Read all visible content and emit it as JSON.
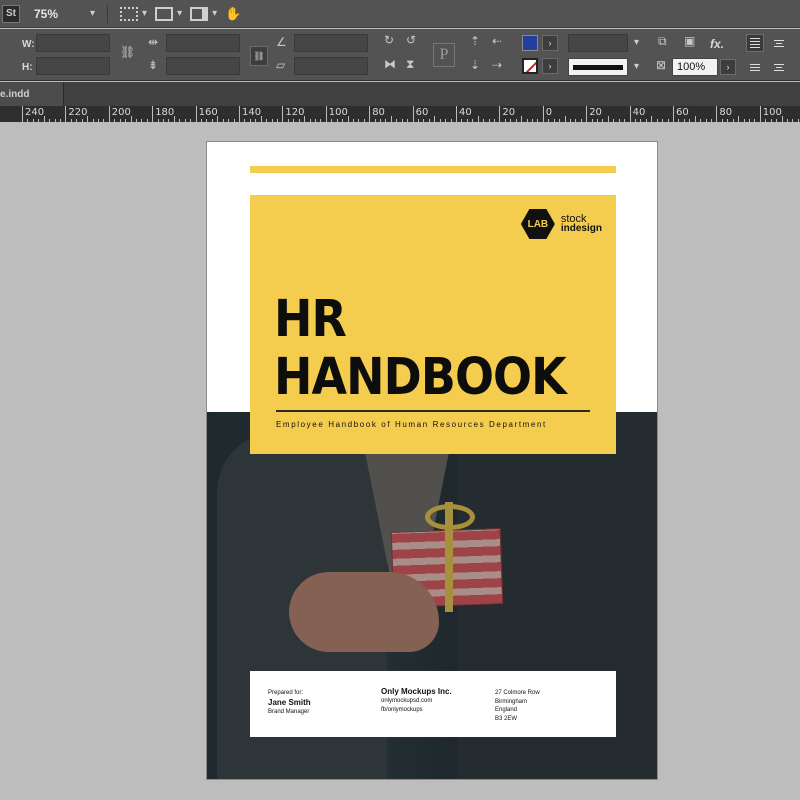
{
  "toolbar": {
    "app_logo": "St",
    "zoom": "75%",
    "icons": [
      "screen-mode-icon",
      "view-options-icon",
      "arrange-documents-icon",
      "hand-icon"
    ]
  },
  "control": {
    "w_label": "W:",
    "h_label": "H:",
    "opacity": "100%",
    "fill_color": "#233e9c",
    "stroke_color": "none",
    "p_button": "P",
    "fx_label": "fx."
  },
  "tab": {
    "filename": "e.indd"
  },
  "ruler": {
    "labels": [
      "240",
      "220",
      "200",
      "180",
      "160",
      "140",
      "120",
      "100",
      "80",
      "60",
      "40",
      "20",
      "0",
      "20",
      "40",
      "60",
      "80",
      "100"
    ]
  },
  "page": {
    "logo_mark": "LAB",
    "logo_top": "stock",
    "logo_bottom": "indesign",
    "title_line1": "HR",
    "title_line2": "HANDBOOK",
    "subtitle": "Employee Handbook of Human Resources Department",
    "footer": {
      "prepared_label": "Prepared for:",
      "name": "Jane Smith",
      "role": "Brand Manager",
      "company": "Only Mockups Inc.",
      "website": "onlymockupsd.com",
      "social": "fb/onlymockups",
      "addr1": "27 Colmore Row",
      "addr2": "Birmingham",
      "addr3": "England",
      "addr4": "B3 2EW"
    },
    "accent": "#f5cd4e"
  }
}
